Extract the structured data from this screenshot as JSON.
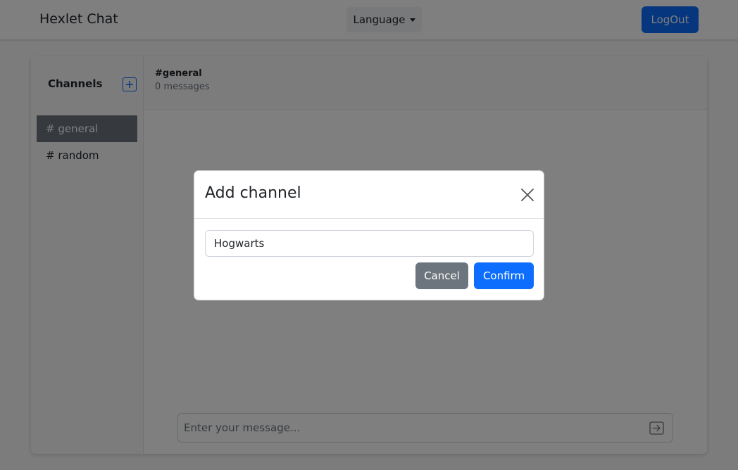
{
  "navbar": {
    "brand": "Hexlet Chat",
    "language_label": "Language",
    "logout_label": "LogOut"
  },
  "sidebar": {
    "title": "Channels",
    "add_icon": "plus-square-icon",
    "channels": [
      {
        "label": "# general",
        "active": true
      },
      {
        "label": "# random",
        "active": false
      }
    ]
  },
  "chat": {
    "channel_name": "#general",
    "message_count": "0 messages",
    "input_placeholder": "Enter your message...",
    "send_icon": "arrow-right-square-icon"
  },
  "modal": {
    "title": "Add channel",
    "close_icon": "close-icon",
    "input_value": "Hogwarts",
    "cancel_label": "Cancel",
    "confirm_label": "Confirm"
  },
  "colors": {
    "primary": "#0d6efd",
    "secondary": "#6c757d",
    "active_channel": "#6c757d"
  }
}
